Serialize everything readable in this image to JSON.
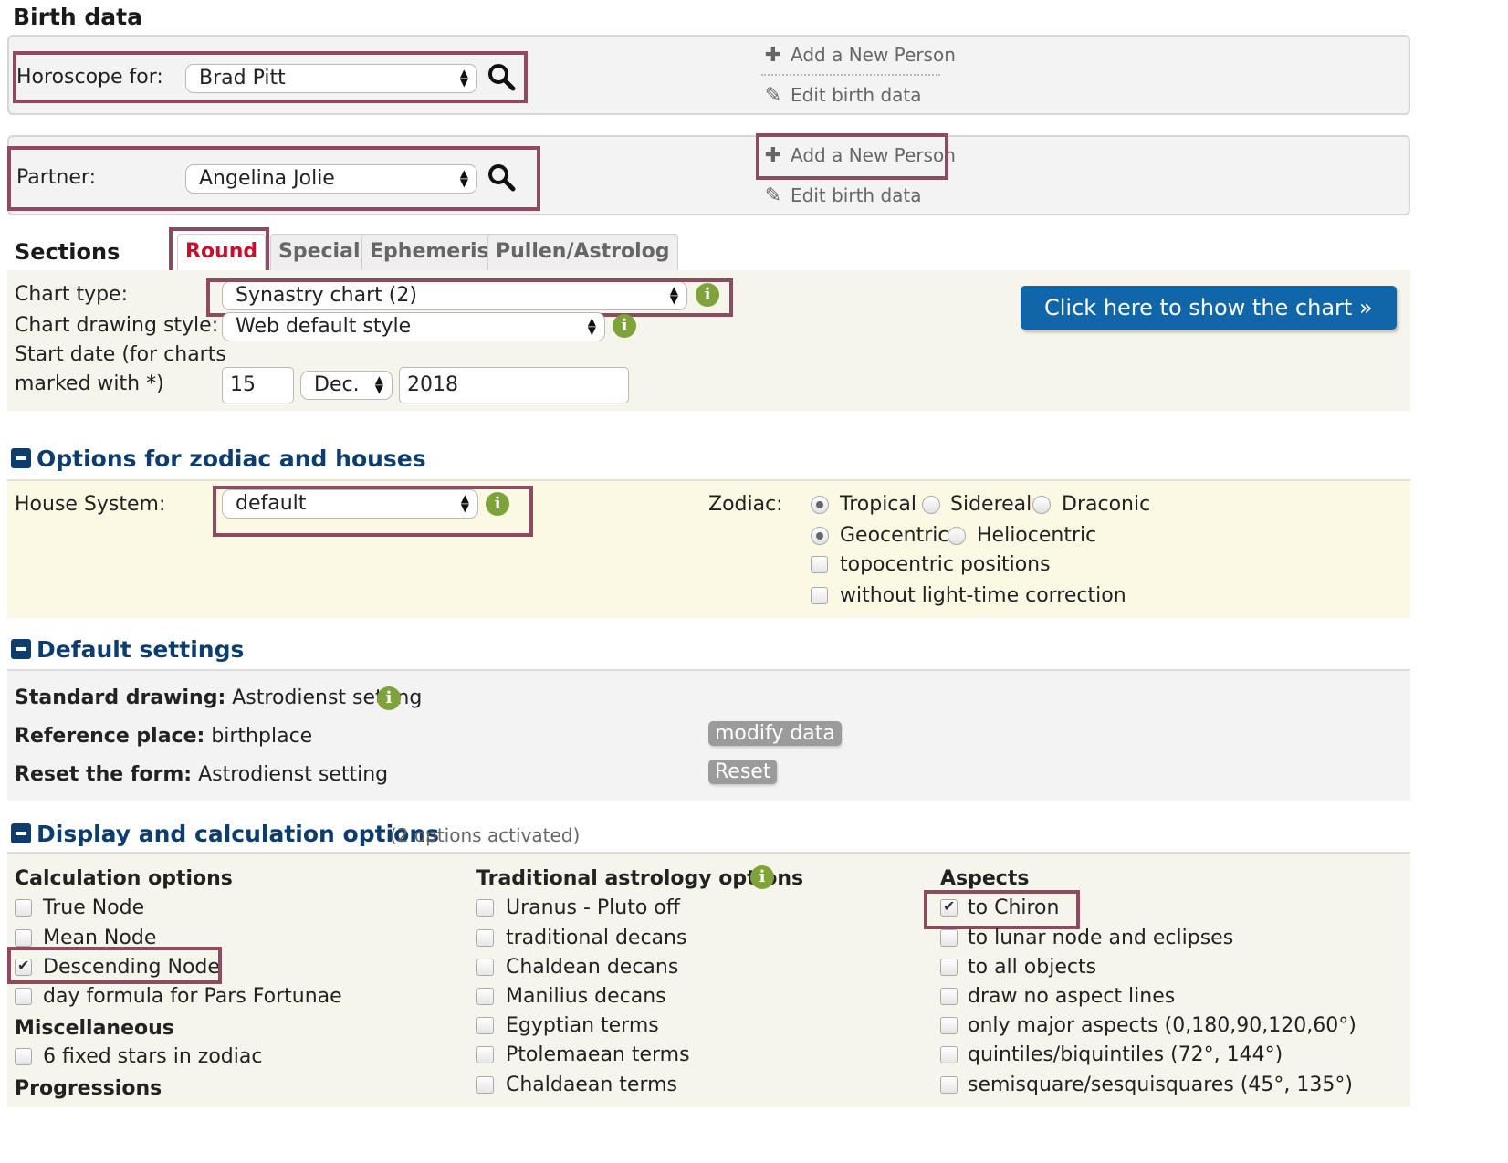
{
  "birth": {
    "heading": "Birth data",
    "horoscope_label": "Horoscope for:",
    "horoscope_value": "Brad Pitt",
    "partner_label": "Partner:",
    "partner_value": "Angelina Jolie",
    "add_person": "Add a New Person",
    "edit_birth": "Edit birth data"
  },
  "sections": {
    "label": "Sections",
    "tabs": [
      "Round",
      "Special",
      "Ephemeris",
      "Pullen/Astrolog"
    ]
  },
  "chart": {
    "type_label": "Chart type:",
    "type_value": "Synastry chart (2)",
    "style_label": "Chart drawing style:",
    "style_value": "Web default style",
    "start_label_1": "Start date (for charts",
    "start_label_2": "marked with *)",
    "day": "15",
    "month": "Dec.",
    "year": "2018",
    "show_button": "Click here to show the chart »"
  },
  "zodiac": {
    "title": "Options for zodiac and houses",
    "house_label": "House System:",
    "house_value": "default",
    "zodiac_label": "Zodiac:",
    "tropical": "Tropical",
    "sidereal": "Sidereal",
    "draconic": "Draconic",
    "geocentric": "Geocentric",
    "heliocentric": "Heliocentric",
    "topocentric": "topocentric positions",
    "lighttime": "without light-time correction"
  },
  "defaults": {
    "title": "Default settings",
    "standard_label": "Standard drawing:",
    "standard_value": "Astrodienst setting",
    "reference_label": "Reference place:",
    "reference_value": "birthplace",
    "reset_label": "Reset the form:",
    "reset_value": "Astrodienst setting",
    "modify_button": "modify data",
    "reset_button": "Reset"
  },
  "display": {
    "title": "Display and calculation options",
    "activated": "(2 options activated)",
    "calc_heading": "Calculation options",
    "calc": [
      {
        "label": "True Node",
        "checked": false
      },
      {
        "label": "Mean Node",
        "checked": false
      },
      {
        "label": "Descending Node",
        "checked": true
      },
      {
        "label": "day formula for Pars Fortunae",
        "checked": false
      }
    ],
    "misc_heading": "Miscellaneous",
    "misc": [
      {
        "label": "6 fixed stars in zodiac",
        "checked": false
      }
    ],
    "prog_heading": "Progressions",
    "trad_heading": "Traditional astrology options",
    "trad": [
      {
        "label": "Uranus - Pluto off",
        "checked": false
      },
      {
        "label": "traditional decans",
        "checked": false
      },
      {
        "label": "Chaldean decans",
        "checked": false
      },
      {
        "label": "Manilius decans",
        "checked": false
      },
      {
        "label": "Egyptian terms",
        "checked": false
      },
      {
        "label": "Ptolemaean terms",
        "checked": false
      },
      {
        "label": "Chaldaean terms",
        "checked": false
      }
    ],
    "aspects_heading": "Aspects",
    "aspects": [
      {
        "label": "to Chiron",
        "checked": true
      },
      {
        "label": "to lunar node and eclipses",
        "checked": false
      },
      {
        "label": "to all objects",
        "checked": false
      },
      {
        "label": "draw no aspect lines",
        "checked": false
      },
      {
        "label": "only major aspects (0,180,90,120,60°)",
        "checked": false
      },
      {
        "label": "quintiles/biquintiles (72°, 144°)",
        "checked": false
      },
      {
        "label": "semisquare/sesquisquares (45°, 135°)",
        "checked": false
      }
    ]
  },
  "icons": {
    "plus": "plus-icon",
    "edit": "edit-icon",
    "search": "search-icon",
    "info": "info-icon",
    "collapse": "minus-icon"
  },
  "colors": {
    "highlight": "#8e4a5e",
    "section_title": "#0d3d6e",
    "button_blue": "#1066a8",
    "active_tab": "#c8102e",
    "info_green": "#7ea33a"
  }
}
